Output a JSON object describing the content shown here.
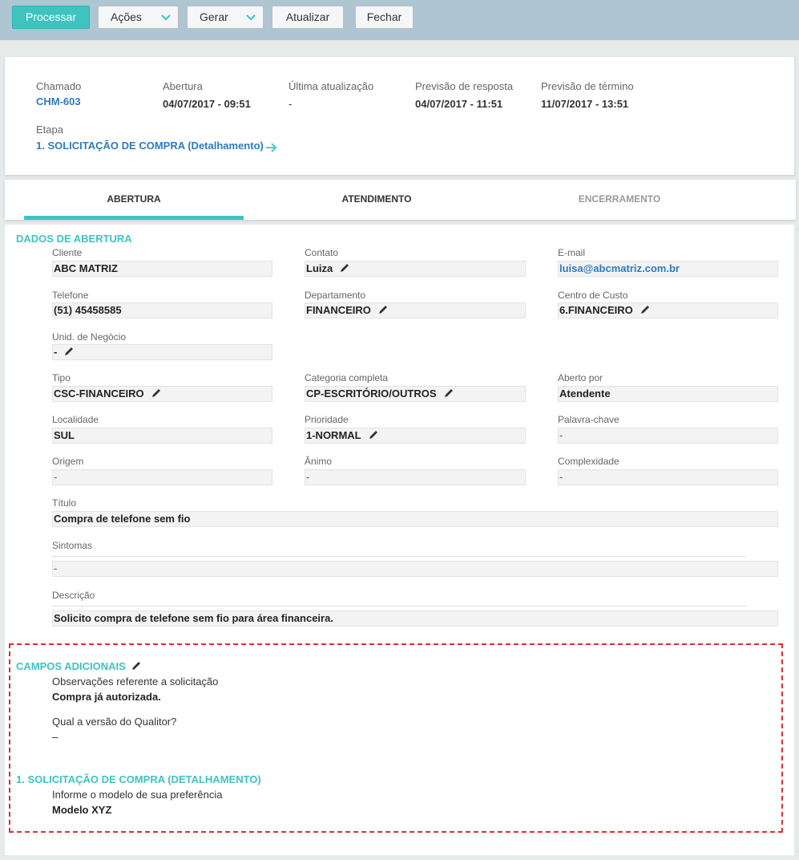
{
  "toolbar": {
    "processar": "Processar",
    "acoes": "Ações",
    "gerar": "Gerar",
    "atualizar": "Atualizar",
    "fechar": "Fechar"
  },
  "header": {
    "chamado_label": "Chamado",
    "chamado_value": "CHM-603",
    "abertura_label": "Abertura",
    "abertura_value": "04/07/2017 - 09:51",
    "ultima_label": "Última atualização",
    "ultima_value": "-",
    "prev_resposta_label": "Previsão de resposta",
    "prev_resposta_value": "04/07/2017 - 11:51",
    "prev_termino_label": "Previsão de término",
    "prev_termino_value": "11/07/2017 - 13:51",
    "etapa_label": "Etapa",
    "etapa_value": "1. SOLICITAÇÃO DE COMPRA (Detalhamento)"
  },
  "tabs": [
    "ABERTURA",
    "ATENDIMENTO",
    "ENCERRAMENTO"
  ],
  "dados": {
    "title": "DADOS DE ABERTURA",
    "cliente_label": "Cliente",
    "cliente": "ABC MATRIZ",
    "contato_label": "Contato",
    "contato": "Luiza",
    "email_label": "E-mail",
    "email": "luisa@abcmatriz.com.br",
    "telefone_label": "Telefone",
    "telefone": "(51) 45458585",
    "departamento_label": "Departamento",
    "departamento": "FINANCEIRO",
    "centro_label": "Centro de Custo",
    "centro": "6.FINANCEIRO",
    "unid_label": "Unid. de Negócio",
    "unid": "-",
    "tipo_label": "Tipo",
    "tipo": "CSC-FINANCEIRO",
    "categoria_label": "Categoria completa",
    "categoria": "CP-ESCRITÓRIO/OUTROS",
    "aberto_label": "Aberto por",
    "aberto": "Atendente",
    "localidade_label": "Localidade",
    "localidade": "SUL",
    "prioridade_label": "Prioridade",
    "prioridade": "1-NORMAL",
    "palavra_label": "Palavra-chave",
    "palavra": "-",
    "origem_label": "Origem",
    "origem": "-",
    "animo_label": "Ânimo",
    "animo": "-",
    "complexidade_label": "Complexidade",
    "complexidade": "-",
    "titulo_label": "Título",
    "titulo": "Compra de telefone sem fio",
    "sintomas_label": "Sintomas",
    "sintomas": "-",
    "descricao_label": "Descrição",
    "descricao": "Solicito compra de telefone sem fio para área financeira."
  },
  "campos": {
    "title": "CAMPOS ADICIONAIS",
    "obs_label": "Observações referente a solicitação",
    "obs_value": "Compra já autorizada.",
    "versao_label": "Qual a versão do Qualitor?",
    "versao_value": "–",
    "etapa_title": "1. SOLICITAÇÃO DE COMPRA (DETALHAMENTO)",
    "modelo_label": "Informe o modelo de sua preferência",
    "modelo_value": "Modelo XYZ"
  },
  "colors": {
    "accent": "#3ec3c1",
    "link": "#2e7bbf",
    "toolbar": "#aec5d2",
    "dashed": "#d93030"
  }
}
